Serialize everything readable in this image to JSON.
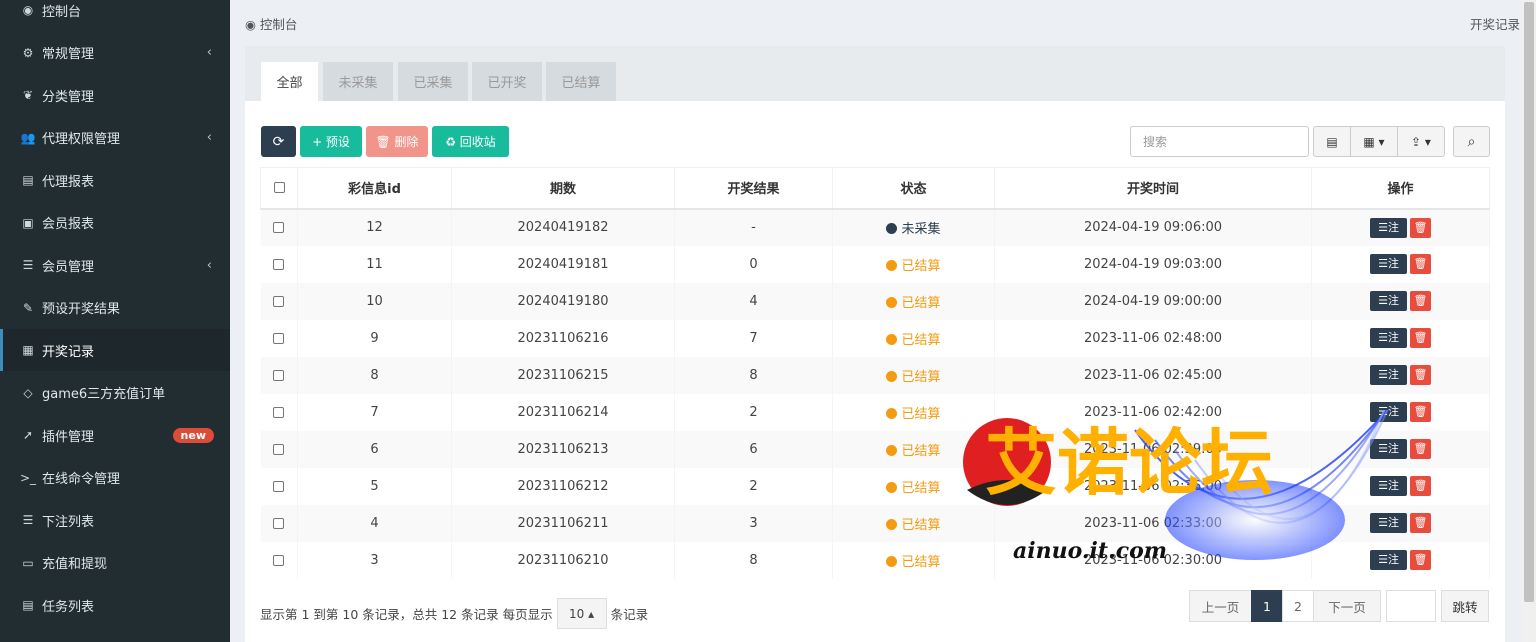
{
  "sidebar": {
    "items": [
      {
        "label": "控制台",
        "icon": "dashboard-icon",
        "glyph": "◉",
        "chevron": "",
        "badge": ""
      },
      {
        "label": "常规管理",
        "icon": "cogs-icon",
        "glyph": "⚙",
        "chevron": "‹",
        "badge": ""
      },
      {
        "label": "分类管理",
        "icon": "leaf-icon",
        "glyph": "❦",
        "chevron": "",
        "badge": ""
      },
      {
        "label": "代理权限管理",
        "icon": "group-icon",
        "glyph": "👥",
        "chevron": "‹",
        "badge": ""
      },
      {
        "label": "代理报表",
        "icon": "book-icon",
        "glyph": "▤",
        "chevron": "",
        "badge": ""
      },
      {
        "label": "会员报表",
        "icon": "user-card-icon",
        "glyph": "▣",
        "chevron": "",
        "badge": ""
      },
      {
        "label": "会员管理",
        "icon": "list-icon",
        "glyph": "☰",
        "chevron": "‹",
        "badge": ""
      },
      {
        "label": "预设开奖结果",
        "icon": "edit-icon",
        "glyph": "✎",
        "chevron": "",
        "badge": ""
      },
      {
        "label": "开奖记录",
        "icon": "calendar-check-icon",
        "glyph": "▦",
        "chevron": "",
        "badge": "",
        "active": true
      },
      {
        "label": "game6三方充值订单",
        "icon": "diamond-icon",
        "glyph": "◇",
        "chevron": "",
        "badge": ""
      },
      {
        "label": "插件管理",
        "icon": "rocket-icon",
        "glyph": "➚",
        "chevron": "",
        "badge": "new"
      },
      {
        "label": "在线命令管理",
        "icon": "terminal-icon",
        "glyph": ">_",
        "chevron": "",
        "badge": ""
      },
      {
        "label": "下注列表",
        "icon": "list-icon",
        "glyph": "☰",
        "chevron": "",
        "badge": ""
      },
      {
        "label": "充值和提现",
        "icon": "money-icon",
        "glyph": "▭",
        "chevron": "",
        "badge": ""
      },
      {
        "label": "任务列表",
        "icon": "book-icon",
        "glyph": "▤",
        "chevron": "",
        "badge": ""
      }
    ]
  },
  "breadcrumb": {
    "home": "控制台",
    "current": "开奖记录"
  },
  "tabs": [
    "全部",
    "未采集",
    "已采集",
    "已开奖",
    "已结算"
  ],
  "toolbar": {
    "refresh_glyph": "⟳",
    "preset_label": "+ 预设",
    "delete_label": "🗑 删除",
    "recycle_label": "♻ 回收站",
    "search_placeholder": "搜索",
    "view_glyph": "▤",
    "columns_glyph": "▦ ▾",
    "export_glyph": "⇪ ▾",
    "search_btn_glyph": "⌕"
  },
  "table": {
    "headers": [
      "彩信息id",
      "期数",
      "开奖结果",
      "状态",
      "开奖时间",
      "操作"
    ],
    "rows": [
      {
        "id": "12",
        "period": "20240419182",
        "result": "-",
        "status": "未采集",
        "status_color": "#2c3e50",
        "time": "2024-04-19 09:06:00"
      },
      {
        "id": "11",
        "period": "20240419181",
        "result": "0",
        "status": "已结算",
        "status_color": "#f39c12",
        "time": "2024-04-19 09:03:00"
      },
      {
        "id": "10",
        "period": "20240419180",
        "result": "4",
        "status": "已结算",
        "status_color": "#f39c12",
        "time": "2024-04-19 09:00:00"
      },
      {
        "id": "9",
        "period": "20231106216",
        "result": "7",
        "status": "已结算",
        "status_color": "#f39c12",
        "time": "2023-11-06 02:48:00"
      },
      {
        "id": "8",
        "period": "20231106215",
        "result": "8",
        "status": "已结算",
        "status_color": "#f39c12",
        "time": "2023-11-06 02:45:00"
      },
      {
        "id": "7",
        "period": "20231106214",
        "result": "2",
        "status": "已结算",
        "status_color": "#f39c12",
        "time": "2023-11-06 02:42:00"
      },
      {
        "id": "6",
        "period": "20231106213",
        "result": "6",
        "status": "已结算",
        "status_color": "#f39c12",
        "time": "2023-11-06 02:39:00"
      },
      {
        "id": "5",
        "period": "20231106212",
        "result": "2",
        "status": "已结算",
        "status_color": "#f39c12",
        "time": "2023-11-06 02:36:00"
      },
      {
        "id": "4",
        "period": "20231106211",
        "result": "3",
        "status": "已结算",
        "status_color": "#f39c12",
        "time": "2023-11-06 02:33:00"
      },
      {
        "id": "3",
        "period": "20231106210",
        "result": "8",
        "status": "已结算",
        "status_color": "#f39c12",
        "time": "2023-11-06 02:30:00"
      }
    ],
    "row_note_label": "注",
    "row_note_glyph": "☰",
    "row_delete_glyph": "🗑"
  },
  "footer": {
    "info_prefix": "显示第 1 到第 10 条记录，总共 12 条记录 每页显示",
    "page_size": "10 ▴",
    "info_suffix": "条记录"
  },
  "pagination": {
    "prev": "上一页",
    "pages": [
      "1",
      "2"
    ],
    "next": "下一页",
    "jump": "跳转"
  },
  "watermark": {
    "title": "艾诺论坛",
    "url": "ainuo.it.com"
  },
  "colors": {
    "sidebar_bg": "#222d32",
    "primary": "#2c3e50",
    "success": "#18bc9c",
    "danger": "#e74c3c",
    "warning": "#f39c12"
  }
}
